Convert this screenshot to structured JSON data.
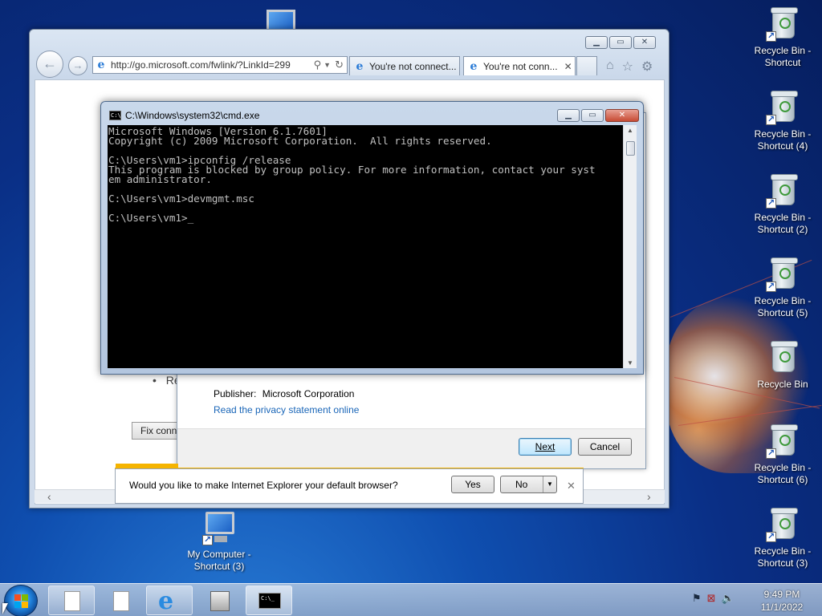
{
  "desktop": {
    "icons_right": [
      {
        "label": "Recycle Bin - Shortcut",
        "shortcut": true
      },
      {
        "label": "Recycle Bin - Shortcut (4)",
        "shortcut": true
      },
      {
        "label": "Recycle Bin - Shortcut (2)",
        "shortcut": true
      },
      {
        "label": "Recycle Bin - Shortcut (5)",
        "shortcut": true
      },
      {
        "label": "Recycle Bin",
        "shortcut": false
      },
      {
        "label": "Recycle Bin - Shortcut (6)",
        "shortcut": true
      },
      {
        "label": "Recycle Bin - Shortcut (3)",
        "shortcut": true
      }
    ],
    "my_computer_label": "My Computer - Shortcut (3)"
  },
  "ie": {
    "address": "http://go.microsoft.com/fwlink/?LinkId=299",
    "tabs": [
      {
        "label": "You're not connect...",
        "active": false
      },
      {
        "label": "You're not conn...",
        "active": true
      }
    ],
    "page_bullet_text": "Re",
    "page_button_label": "Fix conn",
    "notification": {
      "text": "Would you like to make Internet Explorer your default browser?",
      "yes": "Yes",
      "no": "No"
    }
  },
  "setup_dialog": {
    "publisher_label": "Publisher:",
    "publisher_value": "Microsoft Corporation",
    "privacy_link": "Read the privacy statement online",
    "next": "Next",
    "cancel": "Cancel"
  },
  "cmd": {
    "title": "C:\\Windows\\system32\\cmd.exe",
    "lines": [
      "Microsoft Windows [Version 6.1.7601]",
      "Copyright (c) 2009 Microsoft Corporation.  All rights reserved.",
      "",
      "C:\\Users\\vm1>ipconfig /release",
      "This program is blocked by group policy. For more information, contact your syst",
      "em administrator.",
      "",
      "C:\\Users\\vm1>devmgmt.msc",
      "",
      "C:\\Users\\vm1>_"
    ]
  },
  "taskbar": {
    "time": "9:49 PM",
    "date": "11/1/2022"
  },
  "colors": {
    "desktop_blue": "#0a2f86",
    "console_bg": "#000000",
    "console_fg": "#c0c0c0",
    "notification_accent": "#f5b400",
    "link_blue": "#1a66b8"
  }
}
